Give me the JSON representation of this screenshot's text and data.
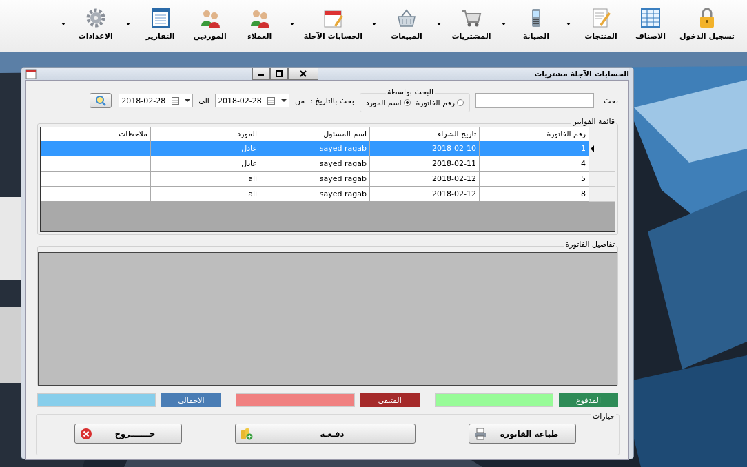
{
  "toolbar": {
    "items": [
      {
        "label": "تسجيل الدخول",
        "kind": "lock",
        "dropdown": false
      },
      {
        "label": "الاصناف",
        "kind": "grid",
        "dropdown": false
      },
      {
        "label": "المنتجات",
        "kind": "note",
        "dropdown": true
      },
      {
        "label": "الصيانة",
        "kind": "phone",
        "dropdown": true
      },
      {
        "label": "المشتريات",
        "kind": "cart",
        "dropdown": true
      },
      {
        "label": "المبيعات",
        "kind": "basket",
        "dropdown": true
      },
      {
        "label": "الحسابات الآجلة",
        "kind": "calendar",
        "dropdown": true
      },
      {
        "label": "العملاء",
        "kind": "people",
        "dropdown": false
      },
      {
        "label": "الموردين",
        "kind": "people",
        "dropdown": false
      },
      {
        "label": "التقارير",
        "kind": "report",
        "dropdown": true
      },
      {
        "label": "الاعدادات",
        "kind": "gear",
        "dropdown": true
      }
    ]
  },
  "window": {
    "title": "الحسابات الآجلة مشتريات"
  },
  "search": {
    "label": "بحث"
  },
  "search_by": {
    "title": "البحث بواسطة",
    "options": [
      {
        "label": "رقم الفاتورة",
        "selected": false
      },
      {
        "label": "اسم المورد",
        "selected": true
      }
    ]
  },
  "date_filter": {
    "label": "بحث بالتاريخ :",
    "from_label": "من",
    "from": "2018-02-28",
    "to_label": "الى",
    "to": "2018-02-28"
  },
  "invoices": {
    "title": "قائمة الفواتير",
    "columns": [
      "رقم الفاتورة",
      "تاريخ الشراء",
      "اسم المسئول",
      "المورد",
      "ملاحظات"
    ],
    "rows": [
      {
        "cells": [
          "1",
          "2018-02-10",
          "sayed ragab",
          "عادل",
          ""
        ],
        "selected": true
      },
      {
        "cells": [
          "4",
          "2018-02-11",
          "sayed ragab",
          "عادل",
          ""
        ],
        "selected": false
      },
      {
        "cells": [
          "5",
          "2018-02-12",
          "sayed ragab",
          "ali",
          ""
        ],
        "selected": false
      },
      {
        "cells": [
          "8",
          "2018-02-12",
          "sayed ragab",
          "ali",
          ""
        ],
        "selected": false
      }
    ]
  },
  "details": {
    "title": "تفاصيل الفاتورة"
  },
  "totals": [
    {
      "label": "المدفوع",
      "kind": "paid",
      "color": "#2e8b57"
    },
    {
      "label": "المتبقى",
      "kind": "remaining",
      "color": "#a52a2a"
    },
    {
      "label": "الاجمالى",
      "kind": "total",
      "color": "#4a7db5"
    }
  ],
  "options": {
    "title": "خيارات",
    "buttons": [
      {
        "label": "طباعة الفاتورة",
        "kind": "print"
      },
      {
        "label": "دفـعـة",
        "kind": "pay"
      },
      {
        "label": "خـــــــروج",
        "kind": "exit"
      }
    ]
  }
}
